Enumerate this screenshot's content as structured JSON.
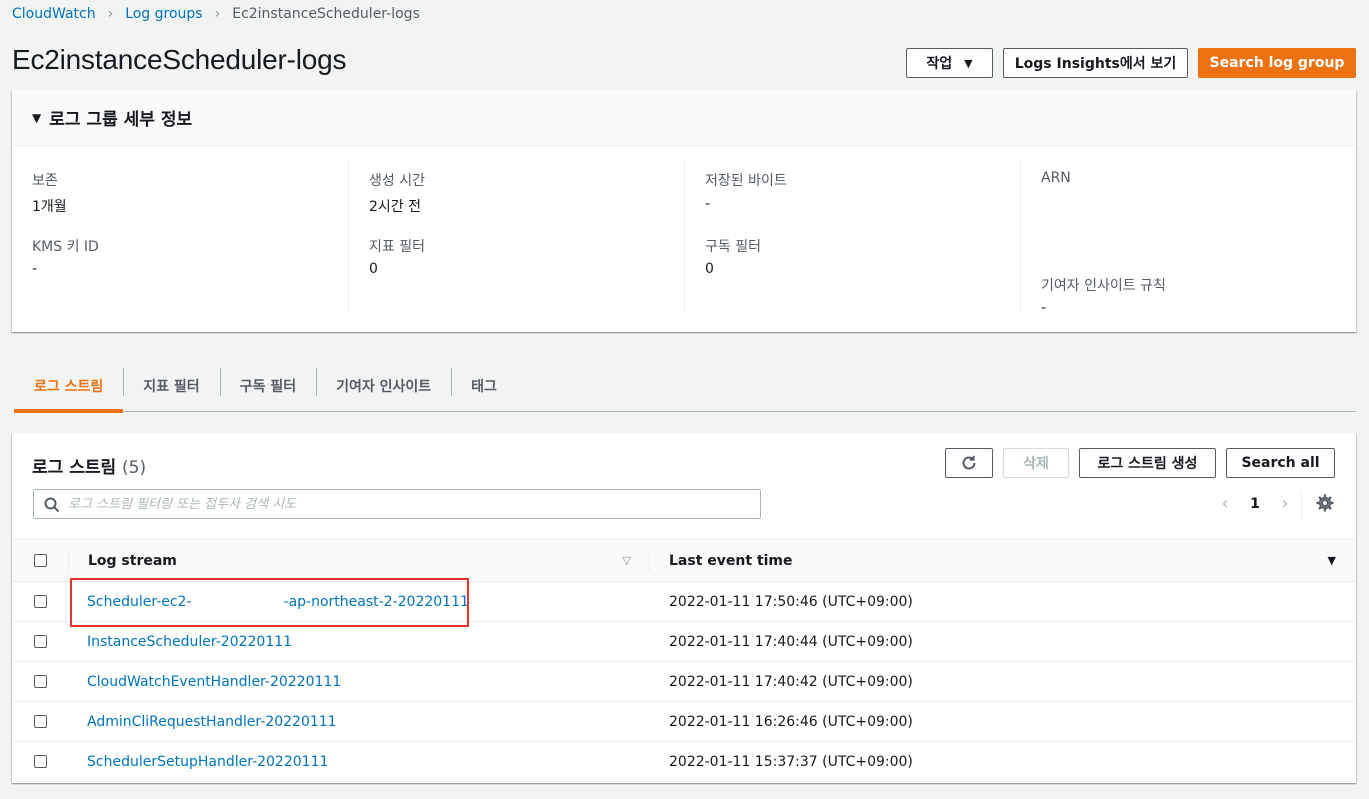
{
  "breadcrumb": {
    "items": [
      "CloudWatch",
      "Log groups"
    ],
    "current": "Ec2instanceScheduler-logs"
  },
  "page": {
    "title": "Ec2instanceScheduler-logs"
  },
  "header_buttons": {
    "actions": "작업",
    "insights": "Logs Insights에서 보기",
    "search": "Search log group"
  },
  "details": {
    "title": "로그 그룹 세부 정보",
    "retention_label": "보존",
    "retention_value": "1개월",
    "kms_label": "KMS 키 ID",
    "kms_value": "-",
    "created_label": "생성 시간",
    "created_value": "2시간 전",
    "metric_filter_label": "지표 필터",
    "metric_filter_value": "0",
    "stored_bytes_label": "저장된 바이트",
    "stored_bytes_value": "-",
    "subscription_label": "구독 필터",
    "subscription_value": "0",
    "arn_label": "ARN",
    "contributor_label": "기여자 인사이트 규칙",
    "contributor_value": "-"
  },
  "tabs": [
    "로그 스트림",
    "지표 필터",
    "구독 필터",
    "기여자 인사이트",
    "태그"
  ],
  "streams": {
    "title": "로그 스트림",
    "count": "(5)",
    "delete_label": "삭제",
    "create_label": "로그 스트림 생성",
    "search_all_label": "Search all",
    "search_placeholder": "로그 스트림 필터링 또는 접두사 검색 시도",
    "page": "1",
    "col_stream": "Log stream",
    "col_time": "Last event time",
    "rows": [
      {
        "name_a": "Scheduler-ec2-",
        "name_b": "-ap-northeast-2-20220111",
        "time": "2022-01-11 17:50:46 (UTC+09:00)"
      },
      {
        "name": "InstanceScheduler-20220111",
        "time": "2022-01-11 17:40:44 (UTC+09:00)"
      },
      {
        "name": "CloudWatchEventHandler-20220111",
        "time": "2022-01-11 17:40:42 (UTC+09:00)"
      },
      {
        "name": "AdminCliRequestHandler-20220111",
        "time": "2022-01-11 16:26:46 (UTC+09:00)"
      },
      {
        "name": "SchedulerSetupHandler-20220111",
        "time": "2022-01-11 15:37:37 (UTC+09:00)"
      }
    ]
  },
  "colors": {
    "accent": "#ec7211",
    "link": "#0073bb",
    "highlight": "#e8332b"
  }
}
